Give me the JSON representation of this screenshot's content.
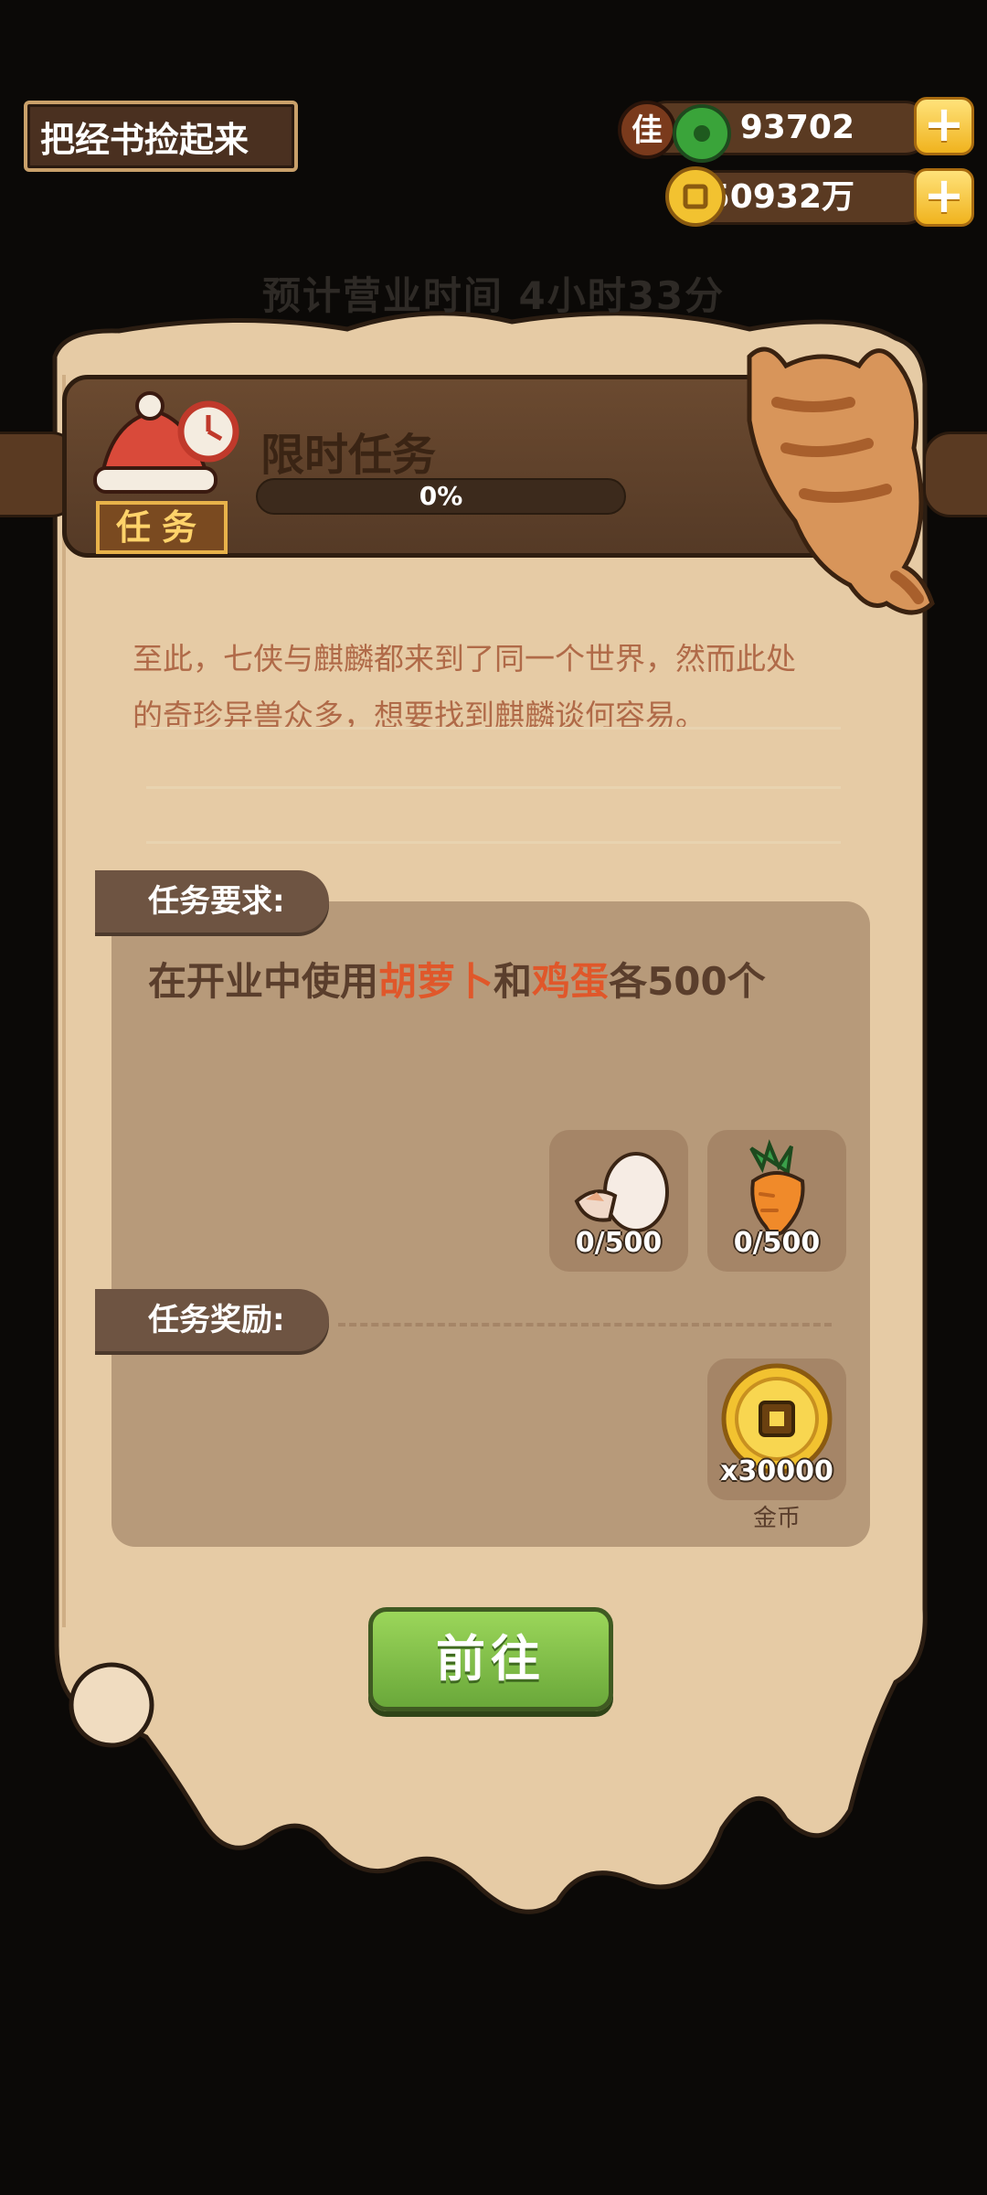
{
  "header": {
    "quest_title": "把经书捡起来",
    "business_time": "预计营业时间 4小时33分"
  },
  "resources": {
    "jade_label": "佳",
    "jade": "93702",
    "gold": "50932万",
    "plus": "+"
  },
  "task": {
    "title": "限时任务",
    "badge": "任务",
    "progress_percent": 0,
    "progress_text": "0%",
    "description_line1": "至此，七侠与麒麟都来到了同一个世界，然而此处",
    "description_line2": "的奇珍异兽众多，想要找到麒麟谈何容易。"
  },
  "requirements": {
    "tag": "任务要求:",
    "text_prefix": "在开业中使用",
    "item_a": "胡萝卜",
    "text_mid": "和",
    "item_b": "鸡蛋",
    "text_suffix": "各500个",
    "items": [
      {
        "icon": "egg-icon",
        "count": "0/500"
      },
      {
        "icon": "carrot-icon",
        "count": "0/500"
      }
    ]
  },
  "rewards": {
    "tag": "任务奖励:",
    "items": [
      {
        "icon": "gold-coin-icon",
        "count": "x30000",
        "name": "金币"
      }
    ]
  },
  "actions": {
    "go_label": "前往"
  },
  "colors": {
    "highlight": "#e0572a",
    "parchment": "#e6cba5",
    "button_green": "#7fbf45"
  }
}
